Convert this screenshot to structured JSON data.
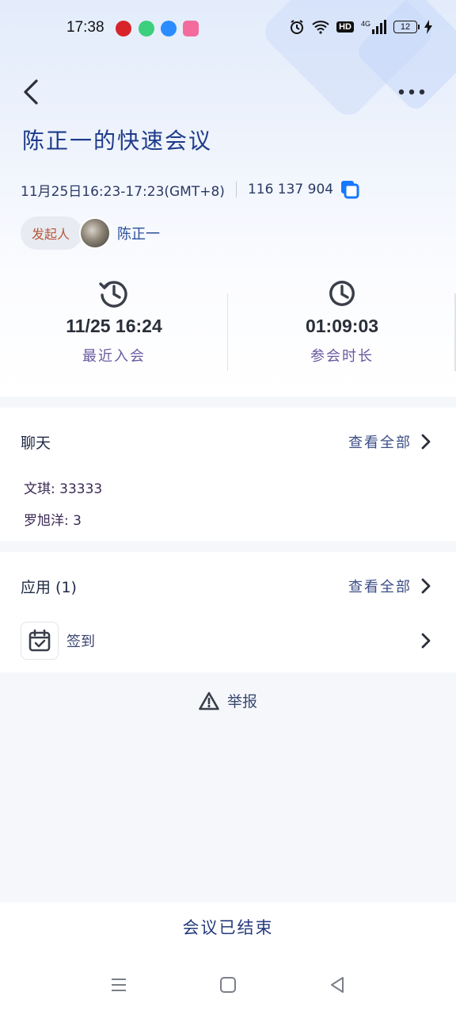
{
  "status_bar": {
    "time": "17:38",
    "battery": "12",
    "hd": "HD",
    "network": "4G"
  },
  "meeting": {
    "title": "陈正一的快速会议",
    "time_range": "11月25日16:23-17:23(GMT+8)",
    "meeting_id": "116 137 904",
    "organizer_label": "发起人",
    "organizer_name": "陈正一"
  },
  "stats": [
    {
      "icon": "history-clock-icon",
      "value": "11/25 16:24",
      "label": "最近入会"
    },
    {
      "icon": "clock-icon",
      "value": "01:09:03",
      "label": "参会时长"
    }
  ],
  "chat": {
    "title": "聊天",
    "view_all": "查看全部",
    "messages": [
      {
        "text": "文琪: 33333"
      },
      {
        "text": "罗旭洋: 3"
      }
    ]
  },
  "apps": {
    "title": "应用 (1)",
    "view_all": "查看全部",
    "items": [
      {
        "icon": "calendar-check-icon",
        "name": "签到"
      }
    ]
  },
  "report": {
    "label": "举报"
  },
  "footer": {
    "ended_label": "会议已结束"
  },
  "colors": {
    "accent": "#1677ff",
    "title": "#1e3b8a",
    "background": "#f5f7fb"
  }
}
